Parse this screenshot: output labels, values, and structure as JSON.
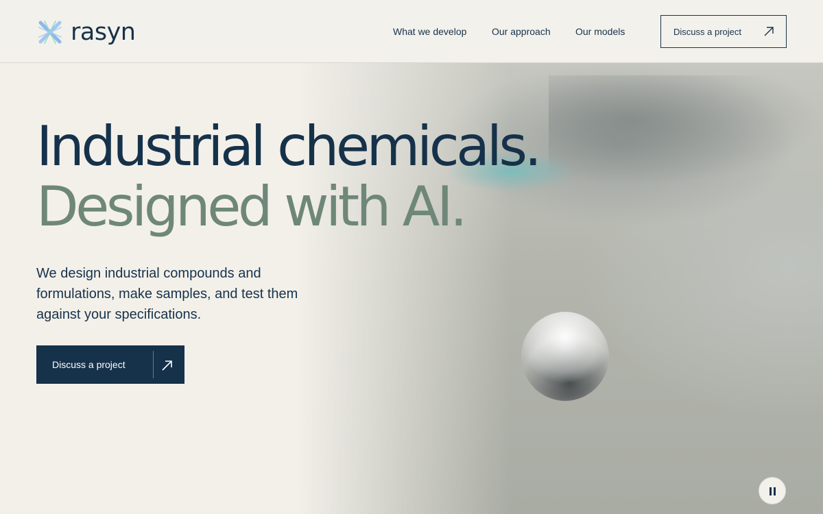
{
  "brand": {
    "name": "rasyn",
    "logo_icon": "x-cross-logo-icon",
    "colors": {
      "navy": "#16324a",
      "sage": "#6e8778",
      "background": "#f3f0ea",
      "logo_blue": "#8bb8e8",
      "logo_teal": "#8fd3c6"
    }
  },
  "nav": {
    "items": [
      {
        "label": "What we develop"
      },
      {
        "label": "Our approach"
      },
      {
        "label": "Our models"
      }
    ],
    "cta_label": "Discuss a project",
    "cta_icon": "arrow-up-right-icon"
  },
  "hero": {
    "headline_line1": "Industrial chemicals.",
    "headline_line2": "Designed with AI.",
    "lede": "We design industrial compounds and formulations, make samples, and test them against your specifications.",
    "cta_label": "Discuss a project",
    "cta_icon": "arrow-up-right-icon"
  },
  "media": {
    "pause_icon": "pause-icon"
  }
}
